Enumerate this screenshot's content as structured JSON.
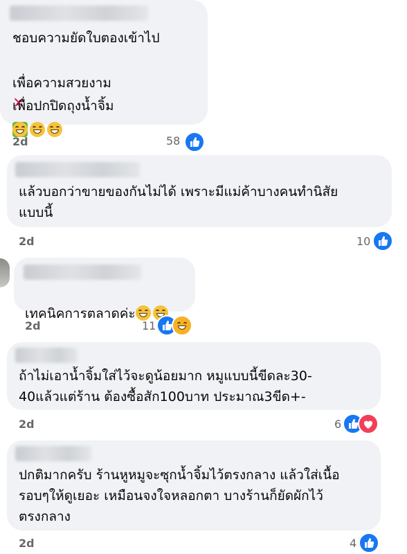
{
  "comments": [
    {
      "line1": "ชอบความยัดใบตองเข้าไป",
      "line2": "เพื่อความสวยงาม",
      "line2_icon": "cross-mark-icon",
      "line3": "เพื่อปกปิดถุงน้ำจิ้ม",
      "line3_icon": "check-mark-icon",
      "emojis": [
        "grinning-face-icon",
        "grinning-face-icon",
        "grinning-face-icon"
      ],
      "time": "2d",
      "reaction_count": "58",
      "reactions": [
        "like"
      ]
    },
    {
      "text": "แล้วบอกว่าขายของกันไม่ได้ เพราะมีแม่ค้าบางคนทำนิสัย\nแบบนี้",
      "time": "2d",
      "reaction_count": "10",
      "reactions": [
        "like"
      ]
    },
    {
      "text": "เทคนิคการตลาดค่ะ",
      "emojis": [
        "tears-of-joy-icon",
        "laughing-face-icon"
      ],
      "time": "2d",
      "reaction_count": "11",
      "reactions": [
        "like",
        "haha"
      ]
    },
    {
      "text": "ถ้าไม่เอาน้ำจิ้มใส่ไว้จะดูน้อยมาก หมูแบบนี้ขีดละ30-\n40แล้วแต่ร้าน ต้องซื้อสัก100บาท ประมาณ3ขีด+-",
      "time": "2d",
      "reaction_count": "6",
      "reactions": [
        "like",
        "love"
      ]
    },
    {
      "text": "ปกติมากครับ ร้านหูหมูจะซุกน้ำจิ้มไว้ตรงกลาง แล้วใส่เนื้อ\nรอบๆให้ดูเยอะ เหมือนจงใจหลอกตา บางร้านก็ยัดผักไว้\nตรงกลาง",
      "time": "2d",
      "reaction_count": "4",
      "reactions": [
        "like"
      ]
    }
  ],
  "colors": {
    "bubble": "#f0f2f5",
    "like_blue": "#1877f2",
    "meta_gray": "#65676b"
  }
}
